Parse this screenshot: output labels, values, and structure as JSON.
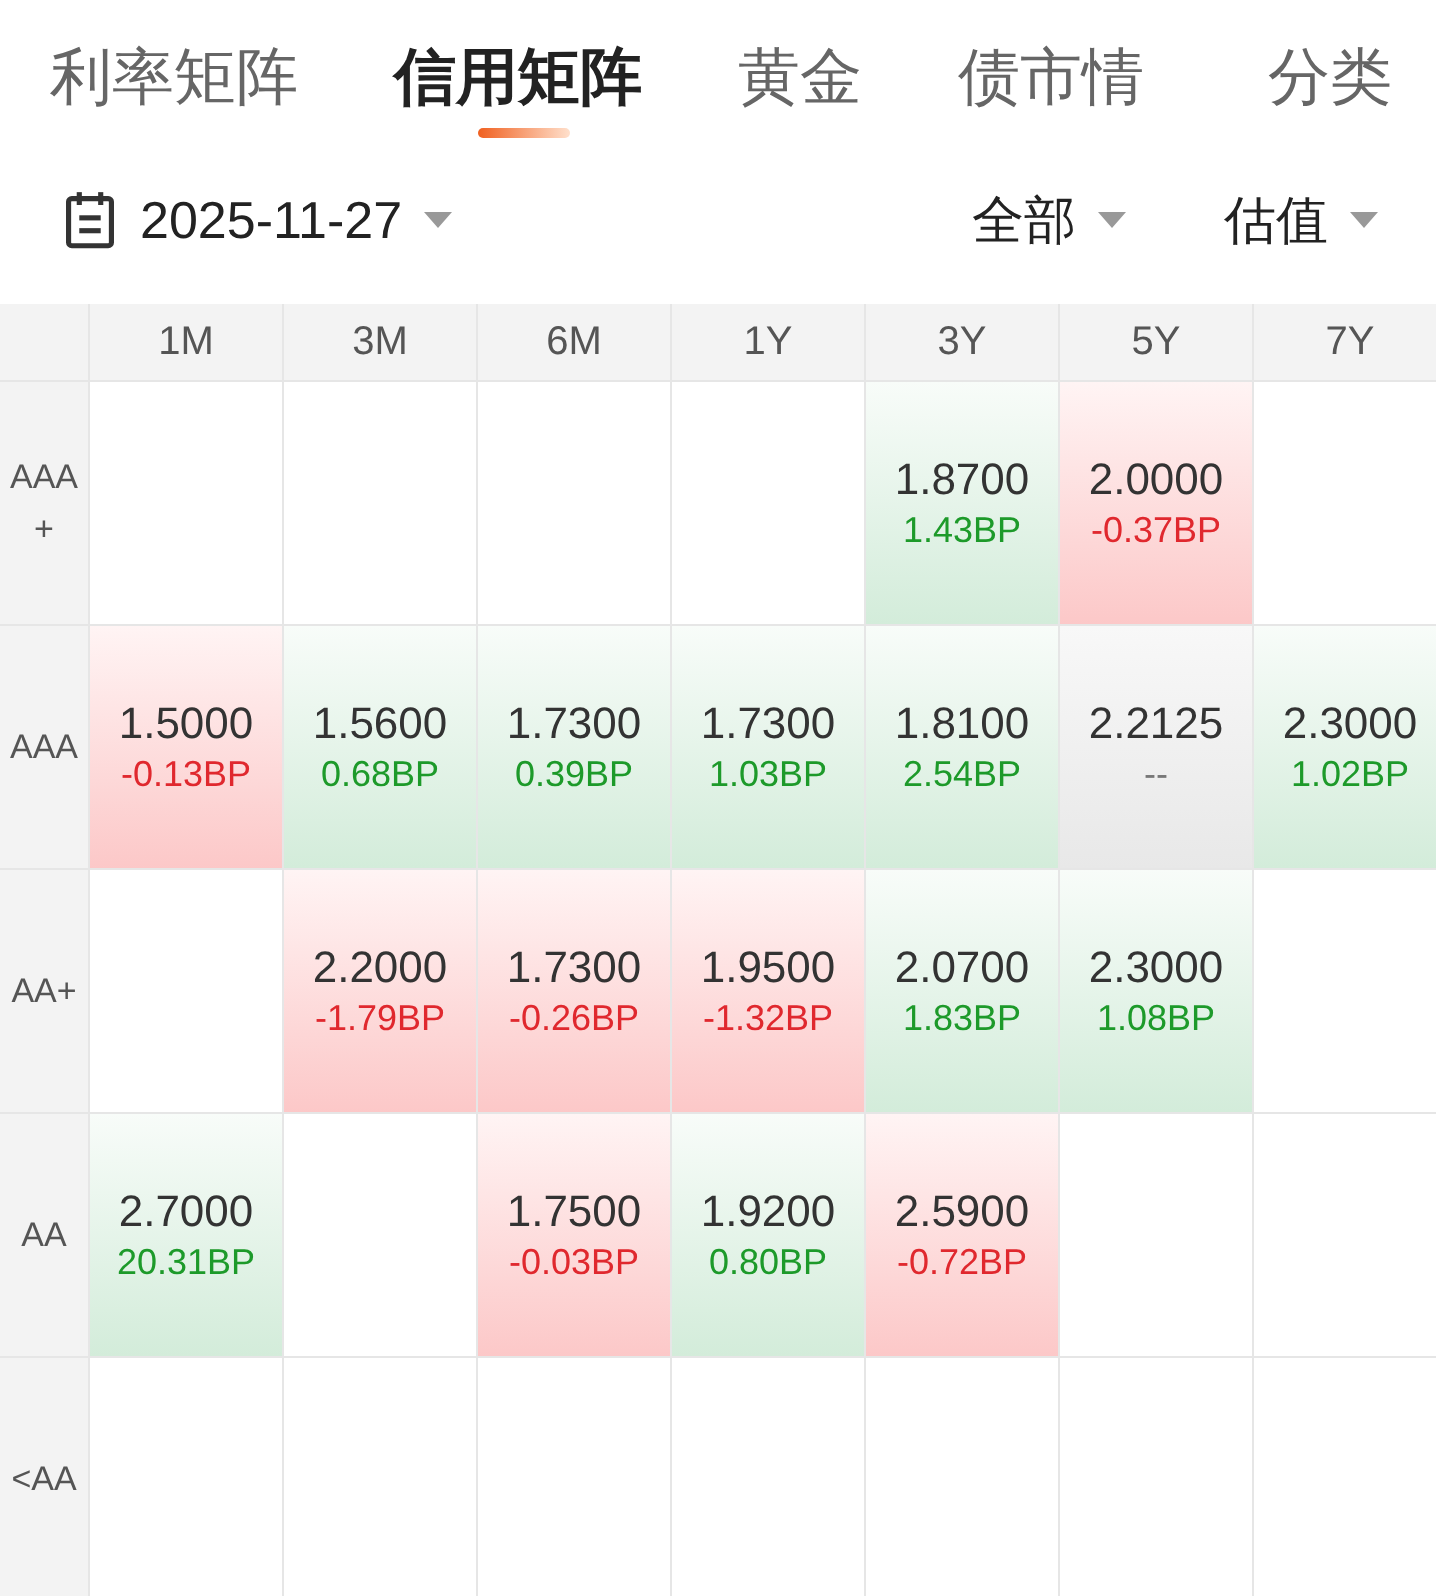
{
  "tabs": [
    {
      "label": "利率矩阵",
      "selected": false
    },
    {
      "label": "信用矩阵",
      "selected": true
    },
    {
      "label": "黄金",
      "selected": false
    },
    {
      "label": "债市情",
      "selected": false
    }
  ],
  "category_button": "分类",
  "filters": {
    "date": "2025-11-27",
    "scope": "全部",
    "measure": "估值"
  },
  "table": {
    "columns": [
      "1M",
      "3M",
      "6M",
      "1Y",
      "3Y",
      "5Y",
      "7Y"
    ],
    "rows": [
      {
        "rating": "AAA\n+",
        "cells": [
          null,
          null,
          null,
          null,
          {
            "value": "1.8700",
            "change": "1.43BP",
            "kind": "up"
          },
          {
            "value": "2.0000",
            "change": "-0.37BP",
            "kind": "down"
          },
          null
        ]
      },
      {
        "rating": "AAA",
        "cells": [
          {
            "value": "1.5000",
            "change": "-0.13BP",
            "kind": "down"
          },
          {
            "value": "1.5600",
            "change": "0.68BP",
            "kind": "up"
          },
          {
            "value": "1.7300",
            "change": "0.39BP",
            "kind": "up"
          },
          {
            "value": "1.7300",
            "change": "1.03BP",
            "kind": "up"
          },
          {
            "value": "1.8100",
            "change": "2.54BP",
            "kind": "up"
          },
          {
            "value": "2.2125",
            "change": "--",
            "kind": "flat"
          },
          {
            "value": "2.3000",
            "change": "1.02BP",
            "kind": "up"
          }
        ]
      },
      {
        "rating": "AA+",
        "cells": [
          null,
          {
            "value": "2.2000",
            "change": "-1.79BP",
            "kind": "down"
          },
          {
            "value": "1.7300",
            "change": "-0.26BP",
            "kind": "down"
          },
          {
            "value": "1.9500",
            "change": "-1.32BP",
            "kind": "down"
          },
          {
            "value": "2.0700",
            "change": "1.83BP",
            "kind": "up"
          },
          {
            "value": "2.3000",
            "change": "1.08BP",
            "kind": "up"
          },
          null
        ]
      },
      {
        "rating": "AA",
        "cells": [
          {
            "value": "2.7000",
            "change": "20.31BP",
            "kind": "up"
          },
          null,
          {
            "value": "1.7500",
            "change": "-0.03BP",
            "kind": "down"
          },
          {
            "value": "1.9200",
            "change": "0.80BP",
            "kind": "up"
          },
          {
            "value": "2.5900",
            "change": "-0.72BP",
            "kind": "down"
          },
          null,
          null
        ]
      },
      {
        "rating": "<AA",
        "cells": [
          null,
          null,
          null,
          null,
          null,
          null,
          null
        ]
      }
    ]
  }
}
